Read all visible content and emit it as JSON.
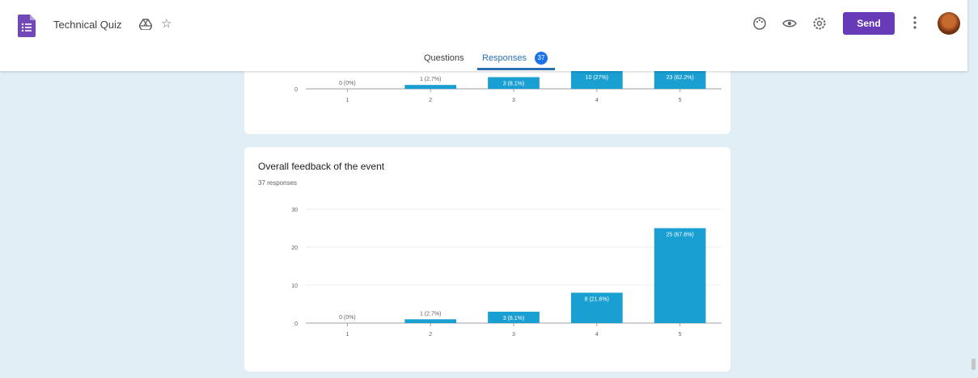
{
  "app": {
    "title": "Technical Quiz",
    "send_label": "Send"
  },
  "icons": {
    "logo": "google-forms-icon",
    "drive": "move-to-drive-icon",
    "star": "star-outline-icon",
    "palette": "palette-icon",
    "preview": "preview-eye-icon",
    "settings": "settings-icon",
    "more": "more-vert-icon",
    "avatar": "user-avatar"
  },
  "tabs": [
    {
      "label": "Questions"
    },
    {
      "label": "Responses",
      "badge": "37"
    }
  ],
  "colors": {
    "accent": "#673ab7",
    "bar": "#1a9fd3",
    "tab_active": "#2a6fb3",
    "background": "#e1eef6"
  },
  "questions": [
    {
      "title": "",
      "count_label": ""
    },
    {
      "title": "Overall feedback of the event",
      "count_label": "37 responses"
    }
  ],
  "chart_data": [
    {
      "type": "bar",
      "categories": [
        "1",
        "2",
        "3",
        "4",
        "5"
      ],
      "values": [
        0,
        1,
        3,
        10,
        23
      ],
      "bar_labels": [
        "0 (0%)",
        "1 (2.7%)",
        "3 (8.1%)",
        "10 (27%)",
        "23 (62.2%)"
      ],
      "ylim": [
        0,
        30
      ]
    },
    {
      "type": "bar",
      "title": "Overall feedback of the event",
      "categories": [
        "1",
        "2",
        "3",
        "4",
        "5"
      ],
      "values": [
        0,
        1,
        3,
        8,
        25
      ],
      "bar_labels": [
        "0 (0%)",
        "1 (2.7%)",
        "3 (8.1%)",
        "8 (21.6%)",
        "25 (67.6%)"
      ],
      "yticks": [
        0,
        10,
        20,
        30
      ],
      "ylim": [
        0,
        30
      ],
      "grid": true
    }
  ]
}
